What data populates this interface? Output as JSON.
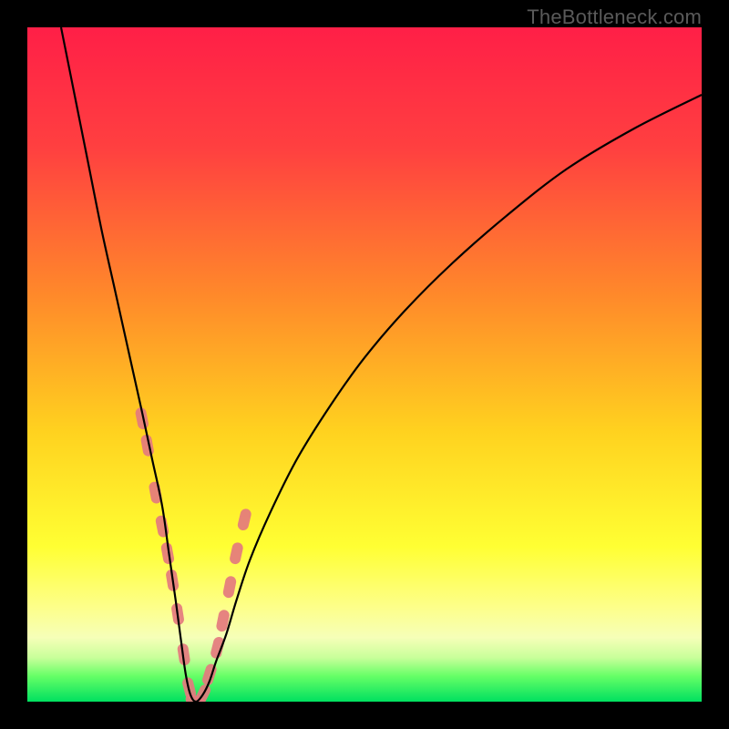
{
  "watermark": "TheBottleneck.com",
  "chart_data": {
    "type": "line",
    "title": "",
    "xlabel": "",
    "ylabel": "",
    "xlim": [
      0,
      100
    ],
    "ylim": [
      0,
      100
    ],
    "gradient_stops": [
      {
        "offset": 0.0,
        "color": "#ff1f47"
      },
      {
        "offset": 0.18,
        "color": "#ff4040"
      },
      {
        "offset": 0.4,
        "color": "#ff8a2a"
      },
      {
        "offset": 0.6,
        "color": "#ffd21f"
      },
      {
        "offset": 0.77,
        "color": "#ffff33"
      },
      {
        "offset": 0.86,
        "color": "#fdff8a"
      },
      {
        "offset": 0.905,
        "color": "#f6ffb8"
      },
      {
        "offset": 0.935,
        "color": "#c8ff9a"
      },
      {
        "offset": 0.962,
        "color": "#66ff66"
      },
      {
        "offset": 1.0,
        "color": "#00e060"
      }
    ],
    "series": [
      {
        "name": "bottleneck-curve",
        "stroke": "#000000",
        "x": [
          5,
          7,
          9,
          11,
          13,
          15,
          17,
          18.5,
          20,
          21,
          22,
          22.8,
          23.5,
          24.2,
          25,
          26,
          27,
          28,
          29.5,
          31,
          33,
          36,
          40,
          45,
          50,
          56,
          63,
          71,
          80,
          90,
          100
        ],
        "y": [
          100,
          90,
          80,
          70,
          61,
          52,
          43,
          36,
          29,
          22,
          15,
          9,
          4,
          1,
          0,
          1,
          3,
          6,
          10,
          15,
          21,
          28,
          36,
          44,
          51,
          58,
          65,
          72,
          79,
          85,
          90
        ]
      },
      {
        "name": "highlight-markers",
        "stroke": "#e47a7e",
        "marker": "rounded",
        "x": [
          17.0,
          17.8,
          19.0,
          20.0,
          20.8,
          21.5,
          22.3,
          23.2,
          24.0,
          25.0,
          26.0,
          27.0,
          28.2,
          29.0,
          30.0,
          31.0,
          32.2
        ],
        "y": [
          42,
          38,
          31,
          26,
          22,
          18,
          13,
          7,
          2,
          0,
          1,
          4,
          8,
          12,
          17,
          22,
          27
        ]
      }
    ]
  }
}
